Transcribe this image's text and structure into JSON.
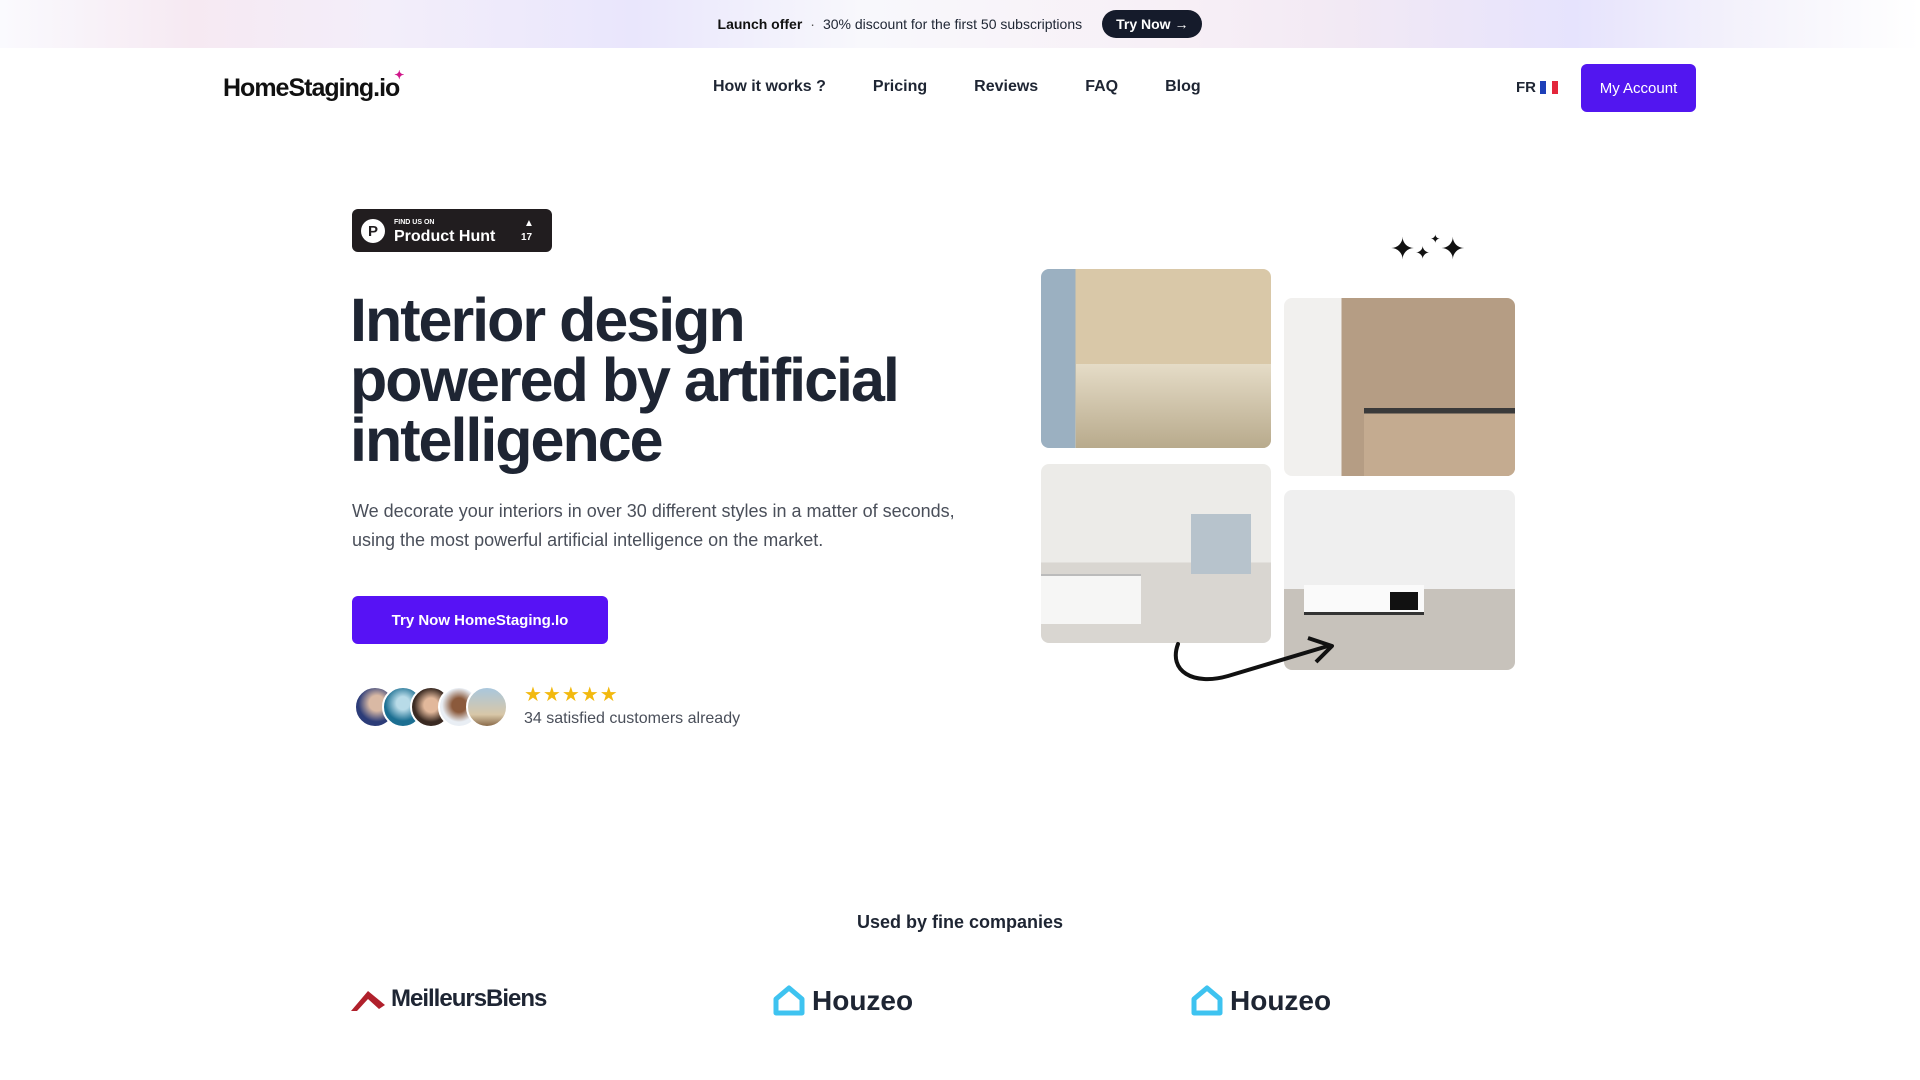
{
  "banner": {
    "label": "Launch offer",
    "separator": "·",
    "text": "30% discount for the first 50 subscriptions",
    "button": "Try Now →"
  },
  "header": {
    "logo": "HomeStaging.io",
    "nav": [
      "How it works ?",
      "Pricing",
      "Reviews",
      "FAQ",
      "Blog"
    ],
    "language": "FR",
    "account_button": "My Account"
  },
  "hero": {
    "badge": {
      "small": "FIND US ON",
      "name": "Product Hunt",
      "upvotes": "17"
    },
    "title": "Interior design powered by artificial intelligence",
    "subtitle": "We decorate your interiors in over 30 different styles in a matter of seconds, using the most powerful artificial intelligence on the market.",
    "cta": "Try Now HomeStaging.Io",
    "rating": {
      "stars": 5,
      "stars_text": "★★★★★",
      "customers": "34 satisfied customers already"
    }
  },
  "companies": {
    "title": "Used by fine companies",
    "logos": [
      "MeilleursBiens",
      "Houzeo",
      "Houzeo"
    ]
  },
  "colors": {
    "accent": "#5216f0",
    "dark": "#151b2b",
    "star": "#f2b90f",
    "houzeo": "#3ec3f0",
    "meilleurs": "#b0202c"
  }
}
